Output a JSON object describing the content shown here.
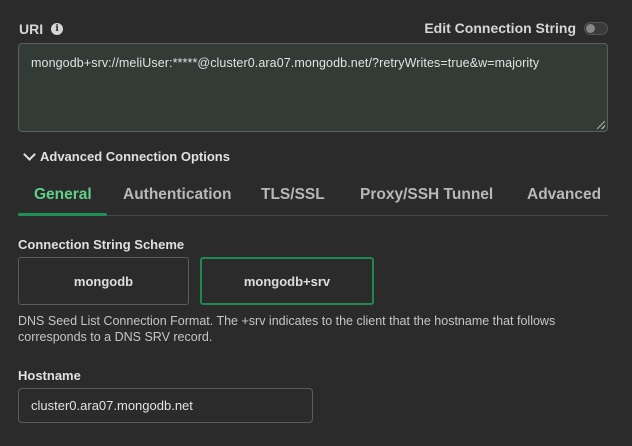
{
  "uri": {
    "label": "URI",
    "info_icon_glyph": "i",
    "value": "mongodb+srv://meliUser:*****@cluster0.ara07.mongodb.net/?retryWrites=true&w=majority"
  },
  "edit_connection": {
    "label": "Edit Connection String",
    "enabled": false
  },
  "advanced": {
    "label": "Advanced Connection Options",
    "expanded": true
  },
  "tabs": [
    {
      "label": "General",
      "active": true
    },
    {
      "label": "Authentication",
      "active": false
    },
    {
      "label": "TLS/SSL",
      "active": false
    },
    {
      "label": "Proxy/SSH Tunnel",
      "active": false
    },
    {
      "label": "Advanced",
      "active": false
    }
  ],
  "scheme": {
    "label": "Connection String Scheme",
    "options": [
      "mongodb",
      "mongodb+srv"
    ],
    "selected": "mongodb+srv",
    "description": "DNS Seed List Connection Format. The +srv indicates to the client that the hostname that follows corresponds to a DNS SRV record."
  },
  "hostname": {
    "label": "Hostname",
    "value": "cluster0.ara07.mongodb.net"
  },
  "colors": {
    "accent_green": "#1e8a52",
    "tab_active_text": "#5fcf8a",
    "background": "#2b2b2b"
  }
}
